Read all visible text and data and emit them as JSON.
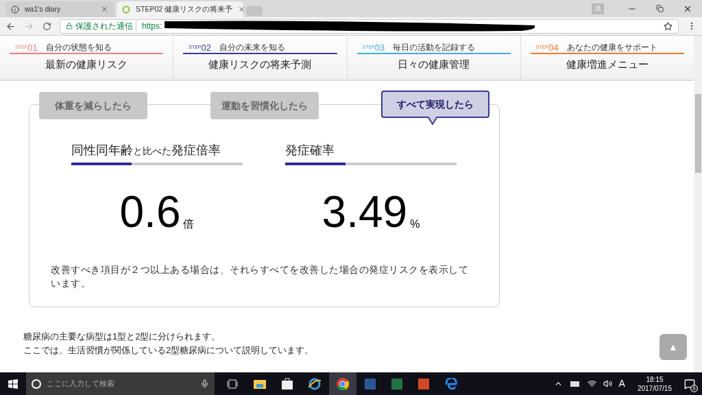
{
  "browser": {
    "tabs": [
      {
        "title": "wa1's diary",
        "selected": false
      },
      {
        "title": "STEP02 健康リスクの将来予",
        "selected": true
      }
    ],
    "security_label": "保護された通信",
    "url": "https:"
  },
  "steps": [
    {
      "step_label": "STEP",
      "number": "01",
      "subtitle": "自分の状態を知る",
      "title": "最新の健康リスク",
      "color": "#f47c7c"
    },
    {
      "step_label": "STEP",
      "number": "02",
      "subtitle": "自分の未来を知る",
      "title": "健康リスクの将来予測",
      "color": "#3a3a9a"
    },
    {
      "step_label": "STEP",
      "number": "03",
      "subtitle": "毎日の活動を記録する",
      "title": "日々の健康管理",
      "color": "#3aaedc"
    },
    {
      "step_label": "STEP",
      "number": "04",
      "subtitle": "あなたの健康をサポート",
      "title": "健康増進メニュー",
      "color": "#f47a2a"
    }
  ],
  "scenario_tabs": [
    {
      "label": "体重を減らしたら",
      "selected": false
    },
    {
      "label": "運動を習慣化したら",
      "selected": false
    },
    {
      "label": "すべて実現したら",
      "selected": true
    }
  ],
  "metrics": [
    {
      "title": "同性同年齢**と比べた**発症倍率",
      "level": 0.35,
      "value": "0.6",
      "unit": "倍"
    },
    {
      "title": "発症確率",
      "level": 0.35,
      "value": "3.49",
      "unit": "%"
    }
  ],
  "note": "改善すべき項目が２つ以上ある場合は、それらすべてを改善した場合の発症リスクを表示しています。",
  "body_lines": [
    "糖尿病の主要な病型は1型と2型に分けられます。",
    "ここでは、生活習慣が関係している2型糖尿病について説明しています。"
  ],
  "back_to_top": "▲",
  "taskbar": {
    "search_placeholder": "ここに入力して検索",
    "time": "18:15",
    "date": "2017/07/15",
    "ime": "A",
    "notification_count": "1"
  }
}
